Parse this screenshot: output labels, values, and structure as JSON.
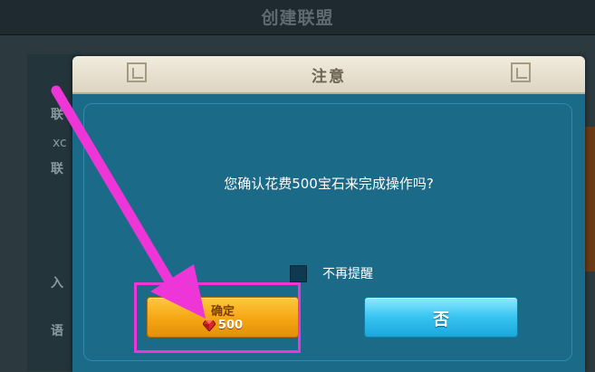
{
  "background": {
    "header_title": "创建联盟",
    "labels": [
      "联",
      "xc",
      "联",
      "入",
      "语"
    ]
  },
  "dialog": {
    "title": "注意",
    "message": "您确认花费500宝石来完成操作吗?",
    "checkbox_label": "不再提醒",
    "checkbox_checked": false,
    "confirm_label": "确定",
    "confirm_cost": "500",
    "cost_icon": "red-gem-icon",
    "no_label": "否"
  },
  "colors": {
    "dialog_body": "#1b6a88",
    "title_bar": "#ece5d4",
    "confirm_button": "#f5a512",
    "no_button": "#36c4f0",
    "annotation": "#ee35d8"
  }
}
